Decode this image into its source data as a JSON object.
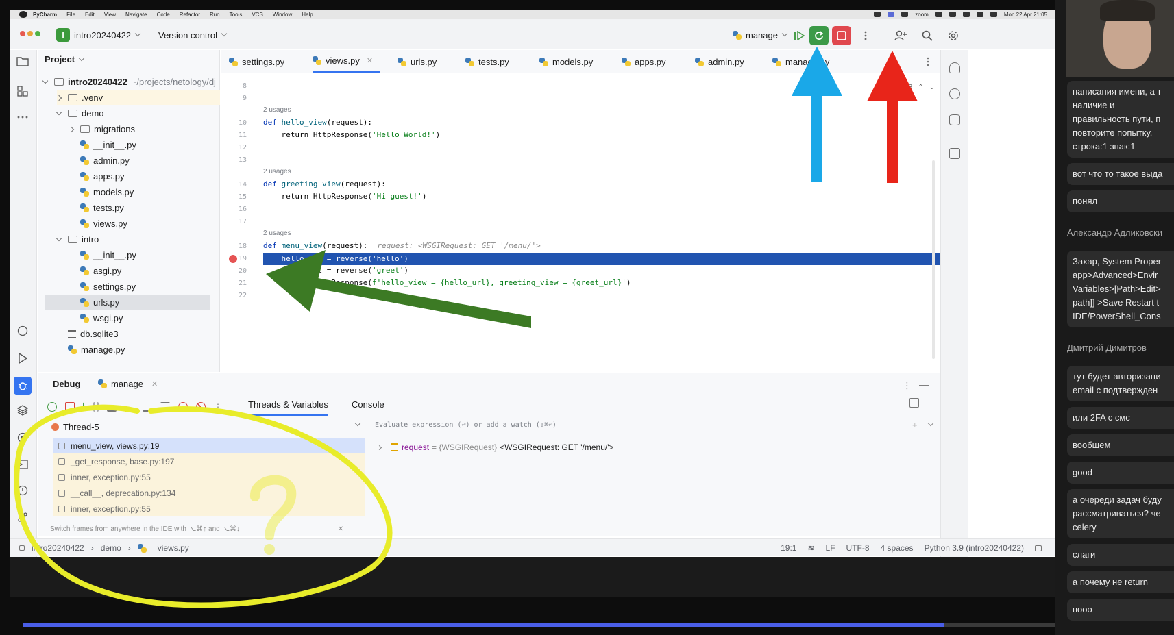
{
  "macbar": {
    "app": "PyCharm",
    "menu": [
      "File",
      "Edit",
      "View",
      "Navigate",
      "Code",
      "Refactor",
      "Run",
      "Tools",
      "VCS",
      "Window",
      "Help"
    ],
    "zoom_label": "zoom",
    "datetime": "Mon 22 Apr 21:05"
  },
  "titlebar": {
    "project_initial": "I",
    "project_name": "intro20240422",
    "vcs_label": "Version control",
    "run_config": "manage"
  },
  "project_panel": {
    "title": "Project",
    "root_name": "intro20240422",
    "root_path": "~/projects/netology/dj",
    "items": [
      {
        "label": ".venv"
      },
      {
        "label": "demo"
      },
      {
        "label": "migrations"
      },
      {
        "label": "__init__.py"
      },
      {
        "label": "admin.py"
      },
      {
        "label": "apps.py"
      },
      {
        "label": "models.py"
      },
      {
        "label": "tests.py"
      },
      {
        "label": "views.py"
      },
      {
        "label": "intro"
      },
      {
        "label": "__init__.py"
      },
      {
        "label": "asgi.py"
      },
      {
        "label": "settings.py"
      },
      {
        "label": "urls.py"
      },
      {
        "label": "wsgi.py"
      },
      {
        "label": "db.sqlite3"
      },
      {
        "label": "manage.py"
      }
    ]
  },
  "tabs": [
    "settings.py",
    "views.py",
    "urls.py",
    "tests.py",
    "models.py",
    "apps.py",
    "admin.py",
    "manage.py"
  ],
  "editor": {
    "warnings": "1",
    "weak_warnings": "3",
    "lines": [
      "8",
      "9",
      "10",
      "11",
      "12",
      "13",
      "14",
      "15",
      "16",
      "17",
      "18",
      "19",
      "20",
      "21",
      "22"
    ],
    "usages": "2 usages",
    "code": {
      "l10_def": "def ",
      "l10_fn": "hello_view",
      "l10_rest": "(request):",
      "l11": "    return HttpResponse(",
      "l11_str": "'Hello World!'",
      "l11_end": ")",
      "l14_def": "def ",
      "l14_fn": "greeting_view",
      "l14_rest": "(request):",
      "l15": "    return HttpResponse(",
      "l15_str": "'Hi guest!'",
      "l15_end": ")",
      "l18_def": "def ",
      "l18_fn": "menu_view",
      "l18_rest": "(request):",
      "l18_hint": "request: <WSGIRequest: GET '/menu/'>",
      "l19": "    hello_url = reverse('hello')",
      "l20a": "    greet_url = reverse(",
      "l20_str": "'greet'",
      "l20_end": ")",
      "l21a": "    return HttpResponse(",
      "l21_str": "f'hello_view = {hello_url}, greeting_view = {greet_url}'",
      "l21_end": ")"
    }
  },
  "debug": {
    "title": "Debug",
    "config": "manage",
    "tab_threads": "Threads & Variables",
    "tab_console": "Console",
    "thread": "Thread-5",
    "frames": [
      "menu_view, views.py:19",
      "_get_response, base.py:197",
      "inner, exception.py:55",
      "__call__, deprecation.py:134",
      "inner, exception.py:55"
    ],
    "eval_placeholder": "Evaluate expression (⏎) or add a watch (⇧⌘⏎)",
    "var_name": "request",
    "var_type": "= {WSGIRequest}",
    "var_value": "<WSGIRequest: GET '/menu/'>",
    "hint": "Switch frames from anywhere in the IDE with ⌥⌘↑ and ⌥⌘↓"
  },
  "statusbar": {
    "crumbs": [
      "intro20240422",
      "demo",
      "views.py"
    ],
    "position": "19:1",
    "line_sep": "LF",
    "encoding": "UTF-8",
    "indent": "4 spaces",
    "interpreter": "Python 3.9 (intro20240422)"
  },
  "video": {
    "progress": 0.8
  },
  "chat": [
    {
      "type": "msg",
      "text": "написания имени, а т\nналичие и\nправильность пути, п\nповторите попытку.\nстрока:1 знак:1"
    },
    {
      "type": "msg",
      "text": "вот что то такое выда"
    },
    {
      "type": "msg",
      "text": "понял"
    },
    {
      "type": "author",
      "text": "Александр Адликовски"
    },
    {
      "type": "msg",
      "text": "Захар, System Proper\napp>Advanced>Envir\nVariables>[Path>Edit>\npath]] >Save Restart t\nIDE/PowerShell_Cons"
    },
    {
      "type": "author",
      "text": "Дмитрий Димитров"
    },
    {
      "type": "msg",
      "text": "тут будет авторизаци\nemail с подтвержден"
    },
    {
      "type": "msg",
      "text": "или 2FA с смс"
    },
    {
      "type": "msg",
      "text": "вообщем"
    },
    {
      "type": "msg",
      "text": "good"
    },
    {
      "type": "msg",
      "text": "а очереди задач буду\nрассматриваться? че\ncelery"
    },
    {
      "type": "msg",
      "text": "слаги"
    },
    {
      "type": "msg",
      "text": "а почему не return"
    },
    {
      "type": "msg",
      "text": "пооо"
    }
  ],
  "colors": {
    "accent": "#3574f0",
    "exec_line": "#2154b0",
    "breakpoint": "#e55353",
    "annot_blue": "#1aa8e8",
    "annot_red": "#e8251a",
    "annot_green": "#3c7a24",
    "annot_yellow": "#e8ec2a"
  }
}
